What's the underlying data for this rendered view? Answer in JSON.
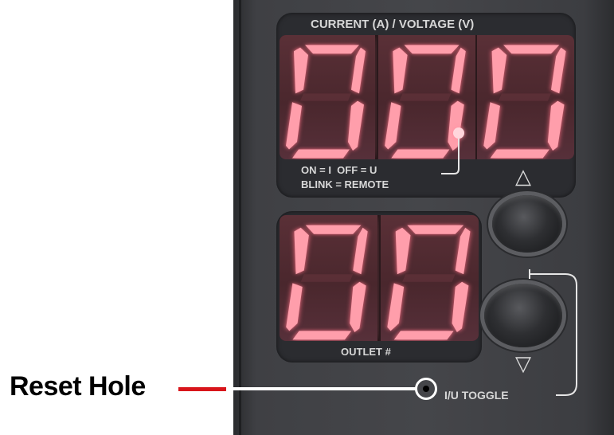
{
  "current_display": {
    "header": "CURRENT (A) / VOLTAGE (V)",
    "digits": [
      "0",
      "0",
      "0"
    ],
    "decimal_after_index": 1,
    "legend_line1": "ON = I  OFF = U",
    "legend_line2": "BLINK = REMOTE"
  },
  "outlet_display": {
    "digits": [
      "0",
      "0"
    ],
    "label": "OUTLET #"
  },
  "buttons": {
    "up_symbol": "△",
    "down_symbol": "▽",
    "toggle_label": "I/U TOGGLE"
  },
  "annotation": {
    "label": "Reset Hole"
  },
  "colors": {
    "segment_on": "#ff9eab",
    "annotation_line": "#d8151b"
  }
}
